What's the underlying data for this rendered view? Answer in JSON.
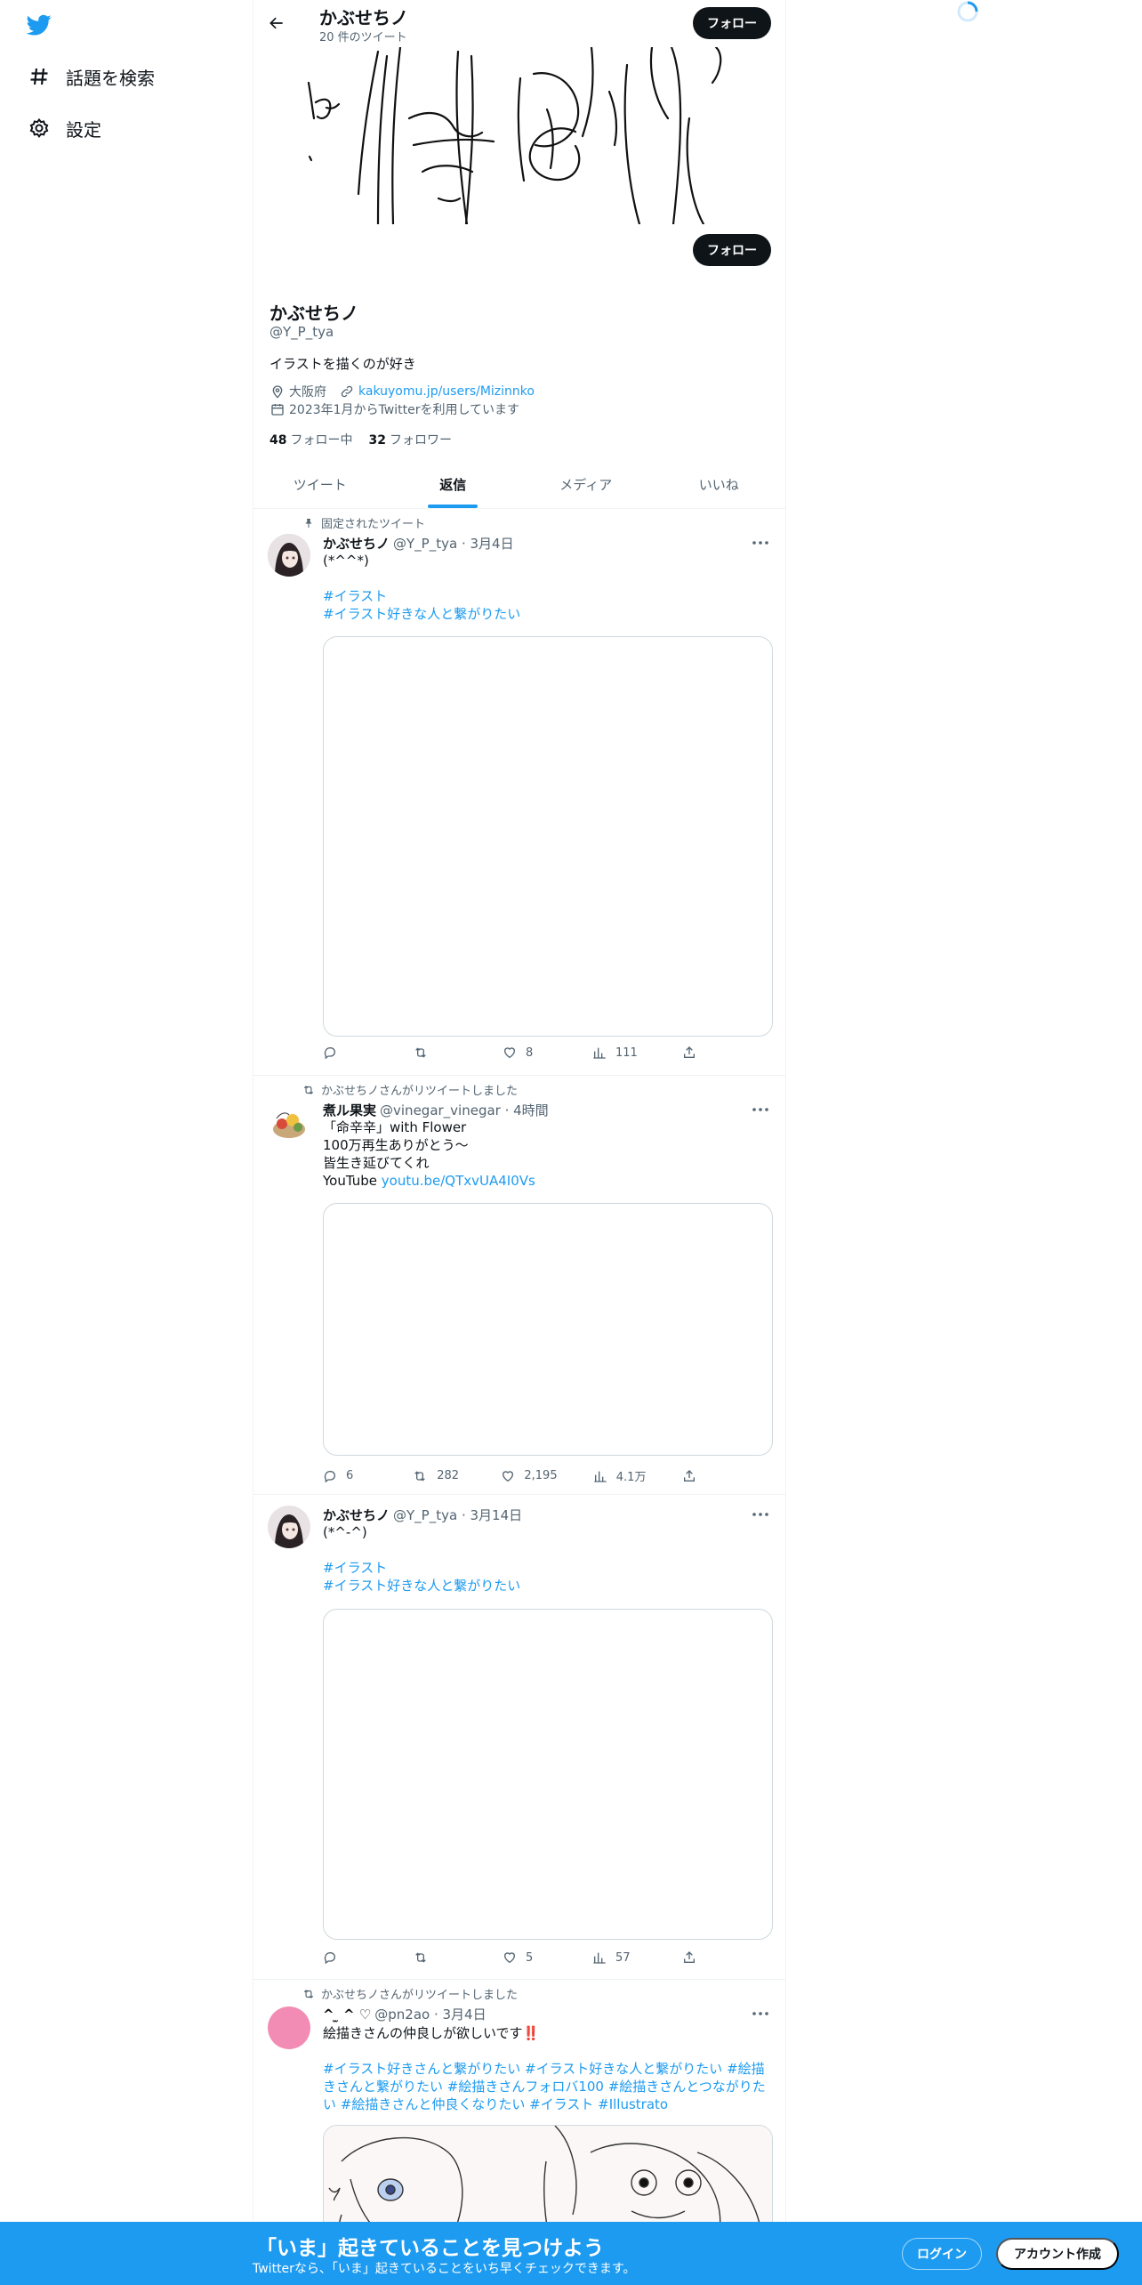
{
  "nav": {
    "explore_label": "話題を検索",
    "settings_label": "設定"
  },
  "header": {
    "name": "かぶせちノ",
    "tweet_count": "20 件のツイート",
    "follow_label": "フォロー"
  },
  "profile": {
    "follow_label": "フォロー",
    "name": "かぶせちノ",
    "handle": "@Y_P_tya",
    "bio": "イラストを描くのが好き",
    "location": "大阪府",
    "website": "kakuyomu.jp/users/Mizinnko",
    "joined": "2023年1月からTwitterを利用しています",
    "following_count": "48",
    "following_label": "フォロー中",
    "followers_count": "32",
    "followers_label": "フォロワー"
  },
  "tabs": [
    {
      "label": "ツイート"
    },
    {
      "label": "返信"
    },
    {
      "label": "メディア"
    },
    {
      "label": "いいね"
    }
  ],
  "tweets": [
    {
      "context": "固定されたツイート",
      "name": "かぶせちノ",
      "handle": "@Y_P_tya · 3月4日",
      "lines": [
        "(*^^*)"
      ],
      "tags": [
        "#イラスト",
        "#イラスト好きな人と繋がりたい"
      ],
      "reply": "",
      "retweet": "",
      "like": "8",
      "views": "111"
    },
    {
      "context": "かぶせちノさんがリツイートしました",
      "name": "煮ル果実",
      "handle": "@vinegar_vinegar · 4時間",
      "lines": [
        "「命辛辛」with Flower",
        "100万再生ありがとう〜",
        "皆生き延びてくれ"
      ],
      "yt_prefix": "YouTube ",
      "yt_link": "youtu.be/QTxvUA4I0Vs",
      "reply": "6",
      "retweet": "282",
      "like": "2,195",
      "views": "4.1万"
    },
    {
      "name": "かぶせちノ",
      "handle": "@Y_P_tya · 3月14日",
      "lines": [
        "(*^-^)"
      ],
      "tags": [
        "#イラスト",
        "#イラスト好きな人と繋がりたい"
      ],
      "reply": "",
      "retweet": "",
      "like": "5",
      "views": "57"
    },
    {
      "context": "かぶせちノさんがリツイートしました",
      "name": "^ ̫ ^ ♡",
      "handle": "@pn2ao · 3月4日",
      "text": "絵描きさんの仲良しが欲しいです‼️",
      "tags_block": "#イラスト好きさんと繋がりたい  #イラスト好きな人と繋がりたい  #絵描きさんと繋がりたい  #絵描きさんフォロバ100  #絵描きさんとつながりたい  #絵描きさんと仲良くなりたい  #イラスト #Illustrato"
    }
  ],
  "bottom": {
    "title": "「いま」起きていることを見つけよう",
    "subtitle": "Twitterなら、「いま」起きていることをいち早くチェックできます。",
    "login": "ログイン",
    "signup": "アカウント作成"
  },
  "colors": {
    "accent": "#1d9bf0",
    "text": "#0f1419",
    "muted": "#536471"
  }
}
